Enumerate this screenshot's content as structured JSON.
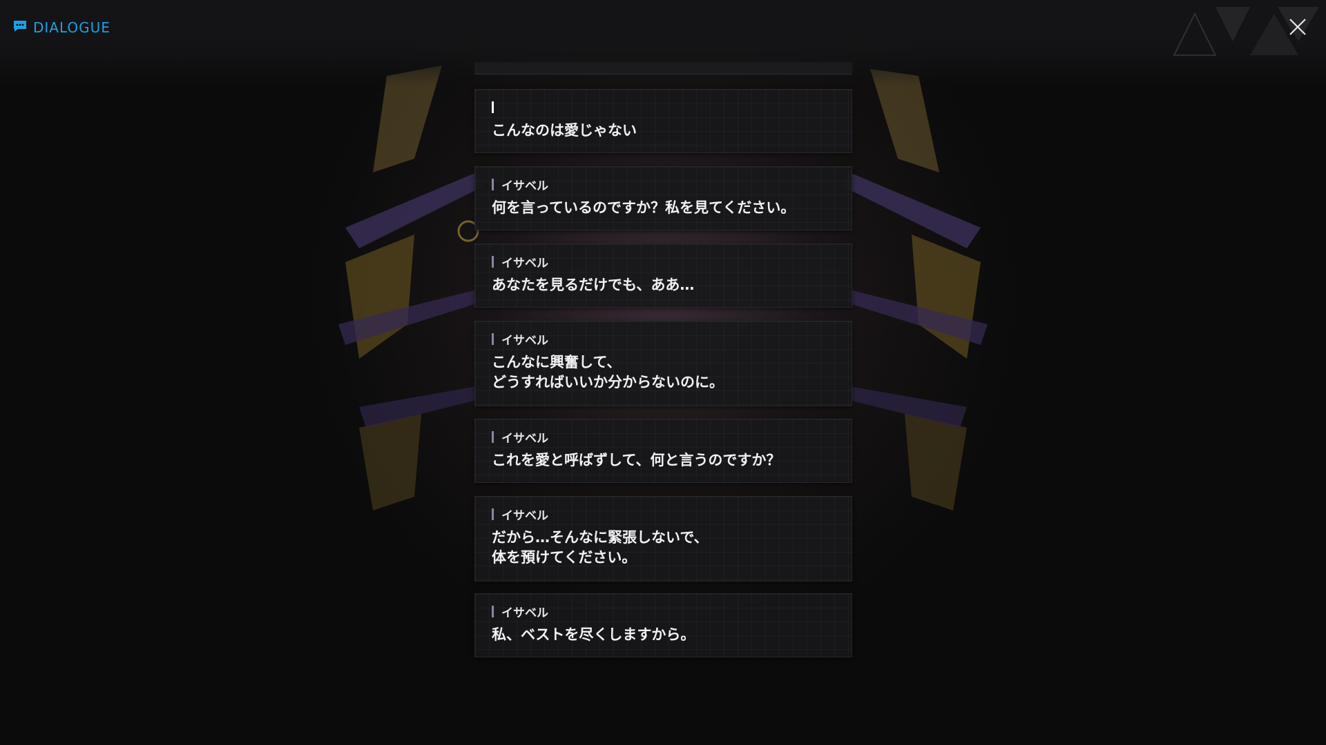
{
  "header": {
    "title": "DIALOGUE",
    "title_icon": "chat-bubble-icon",
    "close_icon": "close-icon",
    "accent_color": "#1da1e6"
  },
  "dialogue": {
    "entries": [
      {
        "speaker": "",
        "text": "こんなのは愛じゃない"
      },
      {
        "speaker": "イサベル",
        "text": "何を言っているのですか？私を見てください。"
      },
      {
        "speaker": "イサベル",
        "text": "あなたを見るだけでも、ああ…"
      },
      {
        "speaker": "イサベル",
        "text": "こんなに興奮して、\nどうすればいいか分からないのに。"
      },
      {
        "speaker": "イサベル",
        "text": "これを愛と呼ばずして、何と言うのですか？"
      },
      {
        "speaker": "イサベル",
        "text": "だから…そんなに緊張しないで、\n体を預けてください。"
      },
      {
        "speaker": "イサベル",
        "text": "私、ベストを尽くしますから。"
      }
    ]
  }
}
